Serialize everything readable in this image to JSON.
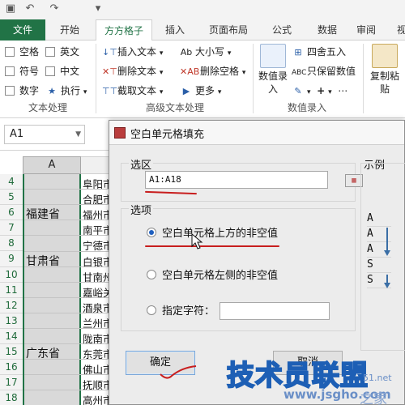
{
  "ribbon_tabs": [
    "文件",
    "开始",
    "方方格子",
    "插入",
    "页面布局",
    "公式",
    "数据",
    "审阅",
    "视"
  ],
  "active_tab": "方方格子",
  "text_group": {
    "checks": [
      "空格",
      "英文",
      "符号",
      "中文",
      "数字"
    ],
    "exec_label": "执行",
    "group_label": "文本处理"
  },
  "advanced_group": {
    "items": [
      "插入文本",
      "删除文本",
      "截取文本",
      "大小写",
      "删除空格",
      "更多"
    ],
    "group_label": "高级文本处理"
  },
  "numeric_group": {
    "big_button": [
      "数值录",
      "入"
    ],
    "items": [
      "四舍五入",
      "只保留数值"
    ],
    "group_label": "数值录入"
  },
  "copy_button": [
    "复制粘",
    "贴"
  ],
  "name_box": "A1",
  "column_header": "A",
  "row_numbers": [
    "4",
    "5",
    "6",
    "7",
    "8",
    "9",
    "10",
    "11",
    "12",
    "13",
    "14",
    "15",
    "16",
    "17",
    "18"
  ],
  "column_a": {
    "6": "福建省",
    "9": "甘肃省",
    "15": "广东省"
  },
  "column_b": [
    "阜阳市",
    "合肥市",
    "福州市",
    "南平市",
    "宁德市",
    "白银市",
    "甘南州",
    "嘉峪关",
    "酒泉市",
    "兰州市",
    "陇南市",
    "东莞市",
    "佛山市",
    "抚顺市",
    "高州市"
  ],
  "dialog": {
    "title": "空白单元格填充",
    "range_label": "选区",
    "range_value": "A1:A18",
    "options_label": "选项",
    "option_above": "空白单元格上方的非空值",
    "option_left": "空白单元格左侧的非空值",
    "option_char": "指定字符：",
    "example_label": "示例",
    "example_values": [
      "A",
      "A",
      "A",
      "S",
      "S"
    ],
    "ok_label": "确定",
    "cancel_label": "取消",
    "selected_option": "above"
  },
  "watermark": {
    "main": "技术员联盟",
    "url": "www.jsgho.com",
    "small": "51.net",
    "tail": "之家"
  },
  "colors": {
    "excel_green": "#217346",
    "annotation_red": "#c81e1e",
    "radio_blue": "#1e5fbf"
  }
}
